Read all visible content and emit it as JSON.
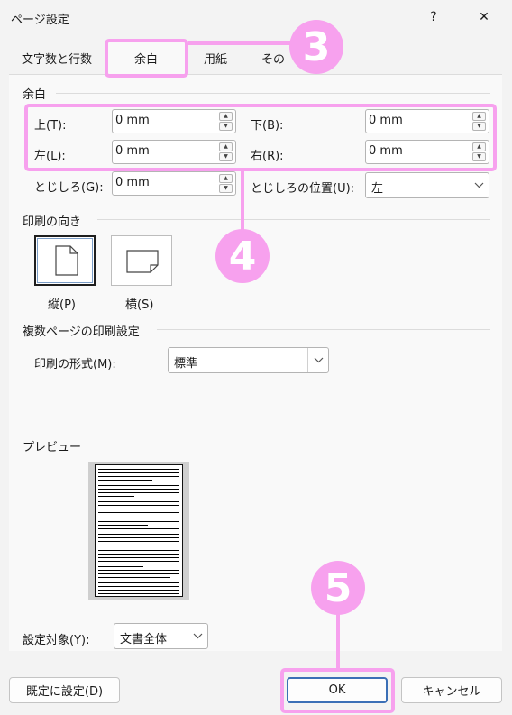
{
  "window": {
    "title": "ページ設定",
    "help_label": "?",
    "close_label": "✕"
  },
  "tabs": [
    {
      "label": "文字数と行数"
    },
    {
      "label": "余白"
    },
    {
      "label": "用紙"
    },
    {
      "label": "その"
    }
  ],
  "margins": {
    "section_title": "余白",
    "top": {
      "label": "上(T):",
      "value": "0 mm"
    },
    "bottom": {
      "label": "下(B):",
      "value": "0 mm"
    },
    "left": {
      "label": "左(L):",
      "value": "0 mm"
    },
    "right": {
      "label": "右(R):",
      "value": "0 mm"
    },
    "gutter": {
      "label": "とじしろ(G):",
      "value": "0 mm"
    },
    "gutter_position": {
      "label": "とじしろの位置(U):",
      "value": "左"
    }
  },
  "orientation": {
    "section_title": "印刷の向き",
    "portrait_label": "縦(P)",
    "landscape_label": "横(S)",
    "selected": "portrait"
  },
  "multiple_pages": {
    "section_title": "複数ページの印刷設定",
    "format_label": "印刷の形式(M):",
    "format_value": "標準"
  },
  "preview": {
    "section_title": "プレビュー"
  },
  "apply_to": {
    "label": "設定対象(Y):",
    "value": "文書全体"
  },
  "buttons": {
    "default": "既定に設定(D)",
    "ok": "OK",
    "cancel": "キャンセル"
  },
  "annotations": {
    "badge_3": "3",
    "badge_4": "4",
    "badge_5": "5",
    "color": "#f7a1ee"
  }
}
